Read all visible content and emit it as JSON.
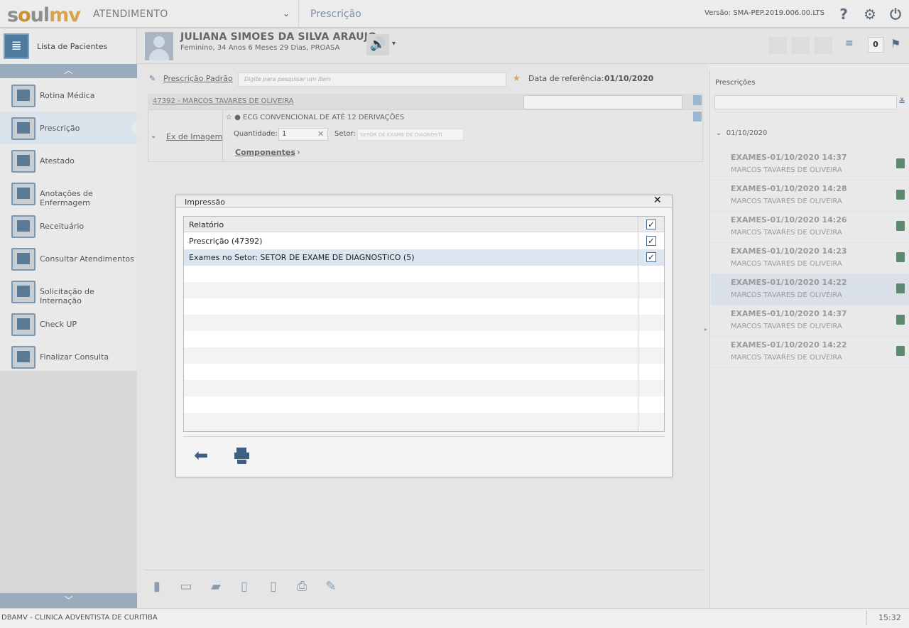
{
  "app": {
    "logo_a": "s",
    "logo_o": "o",
    "logo_b": "ul",
    "logo_mv": "mv",
    "module": "ATENDIMENTO",
    "screen": "Prescrição",
    "version": "Versão: SMA-PEP.2019.006.00.LTS",
    "flag_count": "0"
  },
  "patient": {
    "name": "JULIANA SIMOES DA SILVA ARAUJO",
    "info": "Feminino, 34 Anos 6 Meses 29 Dias, PROASA"
  },
  "sidebar": {
    "list_label": "Lista de Pacientes",
    "items": [
      {
        "label": "Rotina Médica"
      },
      {
        "label": "Prescrição"
      },
      {
        "label": "Atestado"
      },
      {
        "label": "Anotações de Enfermagem"
      },
      {
        "label": "Receituário"
      },
      {
        "label": "Consultar Atendimentos"
      },
      {
        "label": "Solicitação de Internação"
      },
      {
        "label": "Check UP"
      },
      {
        "label": "Finalizar Consulta"
      }
    ]
  },
  "prescription": {
    "standard_label": "Prescrição Padrão",
    "search_placeholder": "Digite para pesquisar um item",
    "ref_label": "Data de referência:",
    "ref_date": "01/10/2020",
    "rx_link": "47392 - MARCOS TAVARES DE OLIVEIRA",
    "item_group": "Ex de Imagem",
    "item_title": "☆ ● ECG CONVENCIONAL DE ATÉ 12 DERIVAÇÕES",
    "qty_label": "Quantidade:",
    "qty_value": "1",
    "setor_label": "Setor:",
    "setor_value": "SETOR DE EXAME DE DIAGNÓSTI",
    "components": "Componentes"
  },
  "right_panel": {
    "title": "Prescrições",
    "date_group": "01/10/2020",
    "items": [
      {
        "title": "EXAMES-01/10/2020 14:37",
        "doctor": "MARCOS TAVARES DE OLIVEIRA"
      },
      {
        "title": "EXAMES-01/10/2020 14:28",
        "doctor": "MARCOS TAVARES DE OLIVEIRA"
      },
      {
        "title": "EXAMES-01/10/2020 14:26",
        "doctor": "MARCOS TAVARES DE OLIVEIRA"
      },
      {
        "title": "EXAMES-01/10/2020 14:23",
        "doctor": "MARCOS TAVARES DE OLIVEIRA"
      },
      {
        "title": "EXAMES-01/10/2020 14:22",
        "doctor": "MARCOS TAVARES DE OLIVEIRA"
      },
      {
        "title": "EXAMES-01/10/2020 14:37",
        "doctor": "MARCOS TAVARES DE OLIVEIRA"
      },
      {
        "title": "EXAMES-01/10/2020 14:22",
        "doctor": "MARCOS TAVARES DE OLIVEIRA"
      }
    ]
  },
  "dialog": {
    "title": "Impressão",
    "close": "✕",
    "column": "Relatório",
    "rows": [
      {
        "label": "Prescrição (47392)",
        "checked": true
      },
      {
        "label": "Exames no Setor: SETOR DE EXAME DE DIAGNOSTICO (5)",
        "checked": true
      }
    ]
  },
  "footer": {
    "org": "DBAMV - CLINICA ADVENTISTA DE CURITIBA",
    "time": "15:32"
  },
  "icons": {
    "help": "question-icon",
    "settings": "gear-icon",
    "power": "power-icon",
    "back": "arrow-left-icon",
    "print": "printer-icon"
  },
  "colors": {
    "accent": "#4f7aa0",
    "brand_orange": "#d9a24e",
    "selected_row": "#dbe5f0"
  }
}
